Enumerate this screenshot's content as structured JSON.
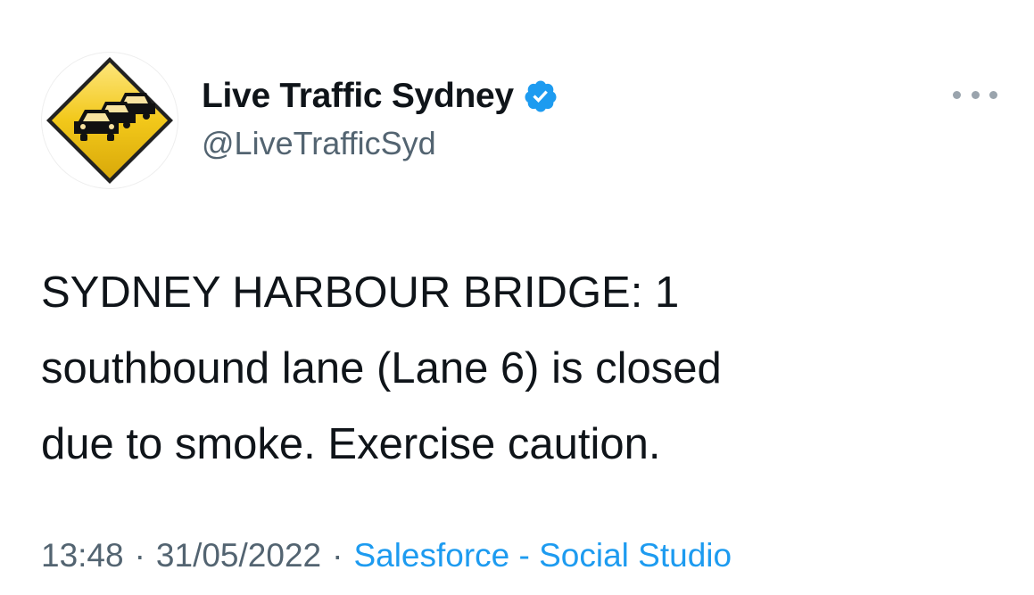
{
  "author": {
    "display_name": "Live Traffic Sydney",
    "handle": "@LiveTrafficSyd",
    "verified": true,
    "avatar_icon": "traffic-jam-sign-icon",
    "verified_icon": "verified-badge-icon"
  },
  "tweet": {
    "lines": [
      "SYDNEY HARBOUR BRIDGE: 1",
      "southbound lane (Lane 6) is closed",
      "due to smoke. Exercise caution."
    ]
  },
  "meta": {
    "time": "13:48",
    "separator": "·",
    "date": "31/05/2022",
    "source": "Salesforce - Social Studio"
  },
  "more_icon": "more-options-icon",
  "colors": {
    "text": "#0f1419",
    "secondary": "#536471",
    "link": "#1d9bf0",
    "verified": "#1d9bf0",
    "sign_yellow": "#f2c81a"
  }
}
